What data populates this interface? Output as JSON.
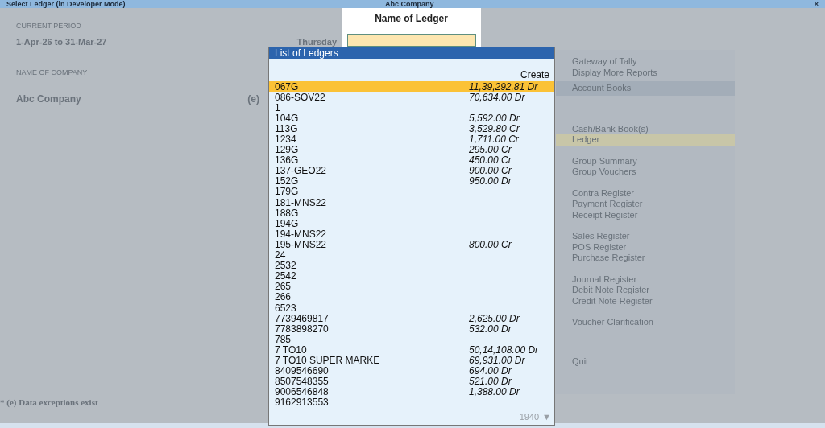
{
  "window": {
    "title": "Select Ledger (in Developer Mode)",
    "company": "Abc Company",
    "close": "×"
  },
  "background": {
    "period_label": "CURRENT PERIOD",
    "period": "1-Apr-26 to 31-Mar-27",
    "day": "Thursday",
    "company_label": "NAME OF COMPANY",
    "company": "Abc Company",
    "company_mark": "(e)",
    "footnote": "* (e) Data exceptions exist",
    "menu": [
      {
        "items": [
          {
            "label": "Gateway of Tally",
            "kind": "item",
            "selected": false
          },
          {
            "label": "Display More Reports",
            "kind": "item",
            "selected": false
          },
          {
            "label": "Account Books",
            "kind": "title",
            "selected": false
          }
        ]
      },
      {
        "items": [
          {
            "label": "Cash/Bank Book(s)",
            "kind": "item",
            "selected": false
          },
          {
            "label": "Ledger",
            "kind": "item",
            "selected": true
          }
        ]
      },
      {
        "items": [
          {
            "label": "Group Summary",
            "kind": "item",
            "selected": false
          },
          {
            "label": "Group Vouchers",
            "kind": "item",
            "selected": false
          }
        ]
      },
      {
        "items": [
          {
            "label": "Contra Register",
            "kind": "item",
            "selected": false
          },
          {
            "label": "Payment Register",
            "kind": "item",
            "selected": false
          },
          {
            "label": "Receipt Register",
            "kind": "item",
            "selected": false
          }
        ]
      },
      {
        "items": [
          {
            "label": "Sales Register",
            "kind": "item",
            "selected": false
          },
          {
            "label": "POS Register",
            "kind": "item",
            "selected": false
          },
          {
            "label": "Purchase Register",
            "kind": "item",
            "selected": false
          }
        ]
      },
      {
        "items": [
          {
            "label": "Journal Register",
            "kind": "item",
            "selected": false
          },
          {
            "label": "Debit Note Register",
            "kind": "item",
            "selected": false
          },
          {
            "label": "Credit Note Register",
            "kind": "item",
            "selected": false
          }
        ]
      },
      {
        "items": [
          {
            "label": "Voucher Clarification",
            "kind": "item",
            "selected": false
          }
        ]
      },
      {
        "items": [
          {
            "label": "Quit",
            "kind": "item",
            "selected": false
          }
        ]
      }
    ]
  },
  "name_prompt": {
    "label": "Name of Ledger"
  },
  "ledger_list": {
    "title": "List of Ledgers",
    "create": "Create",
    "count": "1940",
    "scroll": "▼",
    "rows": [
      {
        "name": "067G",
        "balance": "11,39,292.81 Dr",
        "selected": true
      },
      {
        "name": "086-SOV22",
        "balance": "70,634.00 Dr",
        "selected": false
      },
      {
        "name": "1",
        "selected": false
      },
      {
        "name": "104G",
        "balance": "5,592.00 Dr",
        "selected": false
      },
      {
        "name": "113G",
        "balance": "3,529.80 Cr",
        "selected": false
      },
      {
        "name": "1234",
        "balance": "1,711.00 Cr",
        "selected": false
      },
      {
        "name": "129G",
        "balance": "295.00 Cr",
        "selected": false
      },
      {
        "name": "136G",
        "balance": "450.00 Cr",
        "selected": false
      },
      {
        "name": "137-GEO22",
        "balance": "900.00 Cr",
        "selected": false
      },
      {
        "name": "152G",
        "balance": "950.00 Dr",
        "selected": false
      },
      {
        "name": "179G",
        "selected": false
      },
      {
        "name": "181-MNS22",
        "selected": false
      },
      {
        "name": "188G",
        "selected": false
      },
      {
        "name": "194G",
        "selected": false
      },
      {
        "name": "194-MNS22",
        "selected": false
      },
      {
        "name": "195-MNS22",
        "balance": "800.00 Cr",
        "selected": false
      },
      {
        "name": "24",
        "selected": false
      },
      {
        "name": "2532",
        "selected": false
      },
      {
        "name": "2542",
        "selected": false
      },
      {
        "name": "265",
        "selected": false
      },
      {
        "name": "266",
        "selected": false
      },
      {
        "name": "6523",
        "selected": false
      },
      {
        "name": "7739469817",
        "balance": "2,625.00 Dr",
        "selected": false
      },
      {
        "name": "7783898270",
        "balance": "532.00 Dr",
        "selected": false
      },
      {
        "name": "785",
        "selected": false
      },
      {
        "name": "7 TO10",
        "balance": "50,14,108.00 Dr",
        "selected": false
      },
      {
        "name": "7 TO10 SUPER MARKE",
        "balance": "69,931.00 Dr",
        "selected": false
      },
      {
        "name": "8409546690",
        "balance": "694.00 Dr",
        "selected": false
      },
      {
        "name": "8507548355",
        "balance": "521.00 Dr",
        "selected": false
      },
      {
        "name": "9006546848",
        "balance": "1,388.00 Dr",
        "selected": false
      },
      {
        "name": "9162913553",
        "selected": false
      }
    ]
  }
}
